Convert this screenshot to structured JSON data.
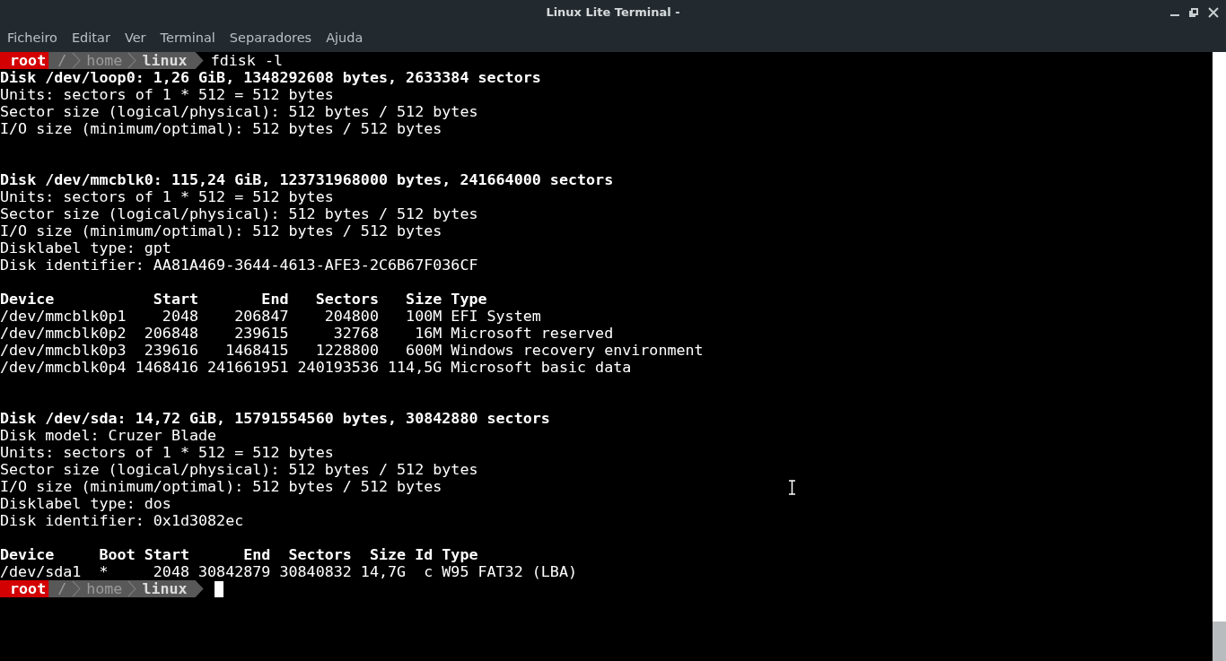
{
  "window": {
    "title": "Linux Lite Terminal -"
  },
  "menu": [
    "Ficheiro",
    "Editar",
    "Ver",
    "Terminal",
    "Separadores",
    "Ajuda"
  ],
  "terminal": {
    "entries": [
      {
        "kind": "prompt",
        "user": "root",
        "path": [
          {
            "text": "/",
            "current": false
          },
          {
            "text": "home",
            "current": false
          },
          {
            "text": "linux",
            "current": true
          }
        ],
        "command": "fdisk -l",
        "cursor": false
      },
      {
        "kind": "text",
        "bold": true,
        "text": "Disk /dev/loop0: 1,26 GiB, 1348292608 bytes, 2633384 sectors"
      },
      {
        "kind": "text",
        "bold": false,
        "text": "Units: sectors of 1 * 512 = 512 bytes"
      },
      {
        "kind": "text",
        "bold": false,
        "text": "Sector size (logical/physical): 512 bytes / 512 bytes"
      },
      {
        "kind": "text",
        "bold": false,
        "text": "I/O size (minimum/optimal): 512 bytes / 512 bytes"
      },
      {
        "kind": "blank"
      },
      {
        "kind": "blank"
      },
      {
        "kind": "text",
        "bold": true,
        "text": "Disk /dev/mmcblk0: 115,24 GiB, 123731968000 bytes, 241664000 sectors"
      },
      {
        "kind": "text",
        "bold": false,
        "text": "Units: sectors of 1 * 512 = 512 bytes"
      },
      {
        "kind": "text",
        "bold": false,
        "text": "Sector size (logical/physical): 512 bytes / 512 bytes"
      },
      {
        "kind": "text",
        "bold": false,
        "text": "I/O size (minimum/optimal): 512 bytes / 512 bytes"
      },
      {
        "kind": "text",
        "bold": false,
        "text": "Disklabel type: gpt"
      },
      {
        "kind": "text",
        "bold": false,
        "text": "Disk identifier: AA81A469-3644-4613-AFE3-2C6B67F036CF"
      },
      {
        "kind": "blank"
      },
      {
        "kind": "text",
        "bold": true,
        "text": "Device           Start       End   Sectors   Size Type"
      },
      {
        "kind": "text",
        "bold": false,
        "text": "/dev/mmcblk0p1    2048    206847    204800   100M EFI System"
      },
      {
        "kind": "text",
        "bold": false,
        "text": "/dev/mmcblk0p2  206848    239615     32768    16M Microsoft reserved"
      },
      {
        "kind": "text",
        "bold": false,
        "text": "/dev/mmcblk0p3  239616   1468415   1228800   600M Windows recovery environment"
      },
      {
        "kind": "text",
        "bold": false,
        "text": "/dev/mmcblk0p4 1468416 241661951 240193536 114,5G Microsoft basic data"
      },
      {
        "kind": "blank"
      },
      {
        "kind": "blank"
      },
      {
        "kind": "text",
        "bold": true,
        "text": "Disk /dev/sda: 14,72 GiB, 15791554560 bytes, 30842880 sectors"
      },
      {
        "kind": "text",
        "bold": false,
        "text": "Disk model: Cruzer Blade"
      },
      {
        "kind": "text",
        "bold": false,
        "text": "Units: sectors of 1 * 512 = 512 bytes"
      },
      {
        "kind": "text",
        "bold": false,
        "text": "Sector size (logical/physical): 512 bytes / 512 bytes"
      },
      {
        "kind": "text",
        "bold": false,
        "text": "I/O size (minimum/optimal): 512 bytes / 512 bytes"
      },
      {
        "kind": "text",
        "bold": false,
        "text": "Disklabel type: dos"
      },
      {
        "kind": "text",
        "bold": false,
        "text": "Disk identifier: 0x1d3082ec"
      },
      {
        "kind": "blank"
      },
      {
        "kind": "text",
        "bold": true,
        "text": "Device     Boot Start      End  Sectors  Size Id Type"
      },
      {
        "kind": "text",
        "bold": false,
        "text": "/dev/sda1  *     2048 30842879 30840832 14,7G  c W95 FAT32 (LBA)"
      },
      {
        "kind": "prompt",
        "user": "root",
        "path": [
          {
            "text": "/",
            "current": false
          },
          {
            "text": "home",
            "current": false
          },
          {
            "text": "linux",
            "current": true
          }
        ],
        "cursor": true
      }
    ]
  }
}
